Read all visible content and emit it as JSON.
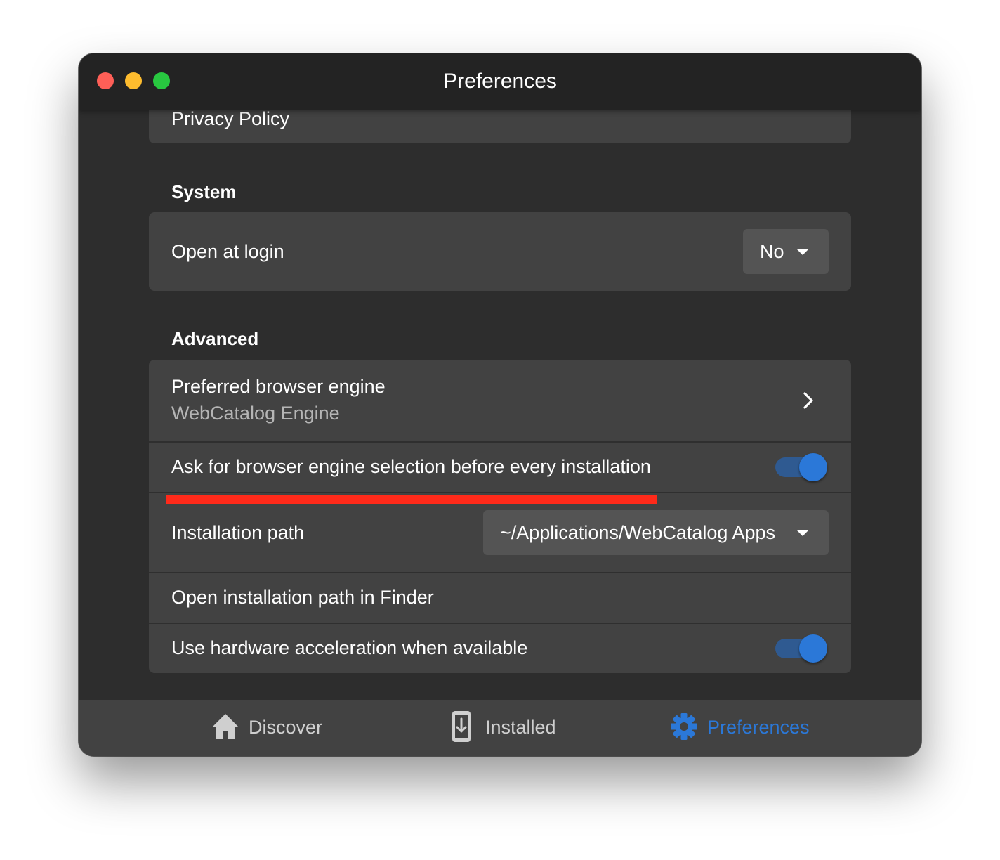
{
  "window": {
    "title": "Preferences"
  },
  "partial_item": {
    "label": "Privacy Policy"
  },
  "system": {
    "header": "System",
    "open_at_login": {
      "label": "Open at login",
      "value": "No"
    }
  },
  "advanced": {
    "header": "Advanced",
    "browser_engine": {
      "label": "Preferred browser engine",
      "value": "WebCatalog Engine"
    },
    "ask_engine": {
      "label": "Ask for browser engine selection before every installation",
      "enabled": true
    },
    "install_path": {
      "label": "Installation path",
      "value": "~/Applications/WebCatalog Apps"
    },
    "open_path": {
      "label": "Open installation path in Finder"
    },
    "hw_accel": {
      "label": "Use hardware acceleration when available",
      "enabled": true
    }
  },
  "nav": {
    "items": [
      {
        "label": "Discover",
        "icon": "home-icon",
        "active": false
      },
      {
        "label": "Installed",
        "icon": "install-device-icon",
        "active": false
      },
      {
        "label": "Preferences",
        "icon": "gear-icon",
        "active": true
      }
    ]
  },
  "colors": {
    "accent": "#2b78d8",
    "annotation": "#ff2a1a"
  }
}
